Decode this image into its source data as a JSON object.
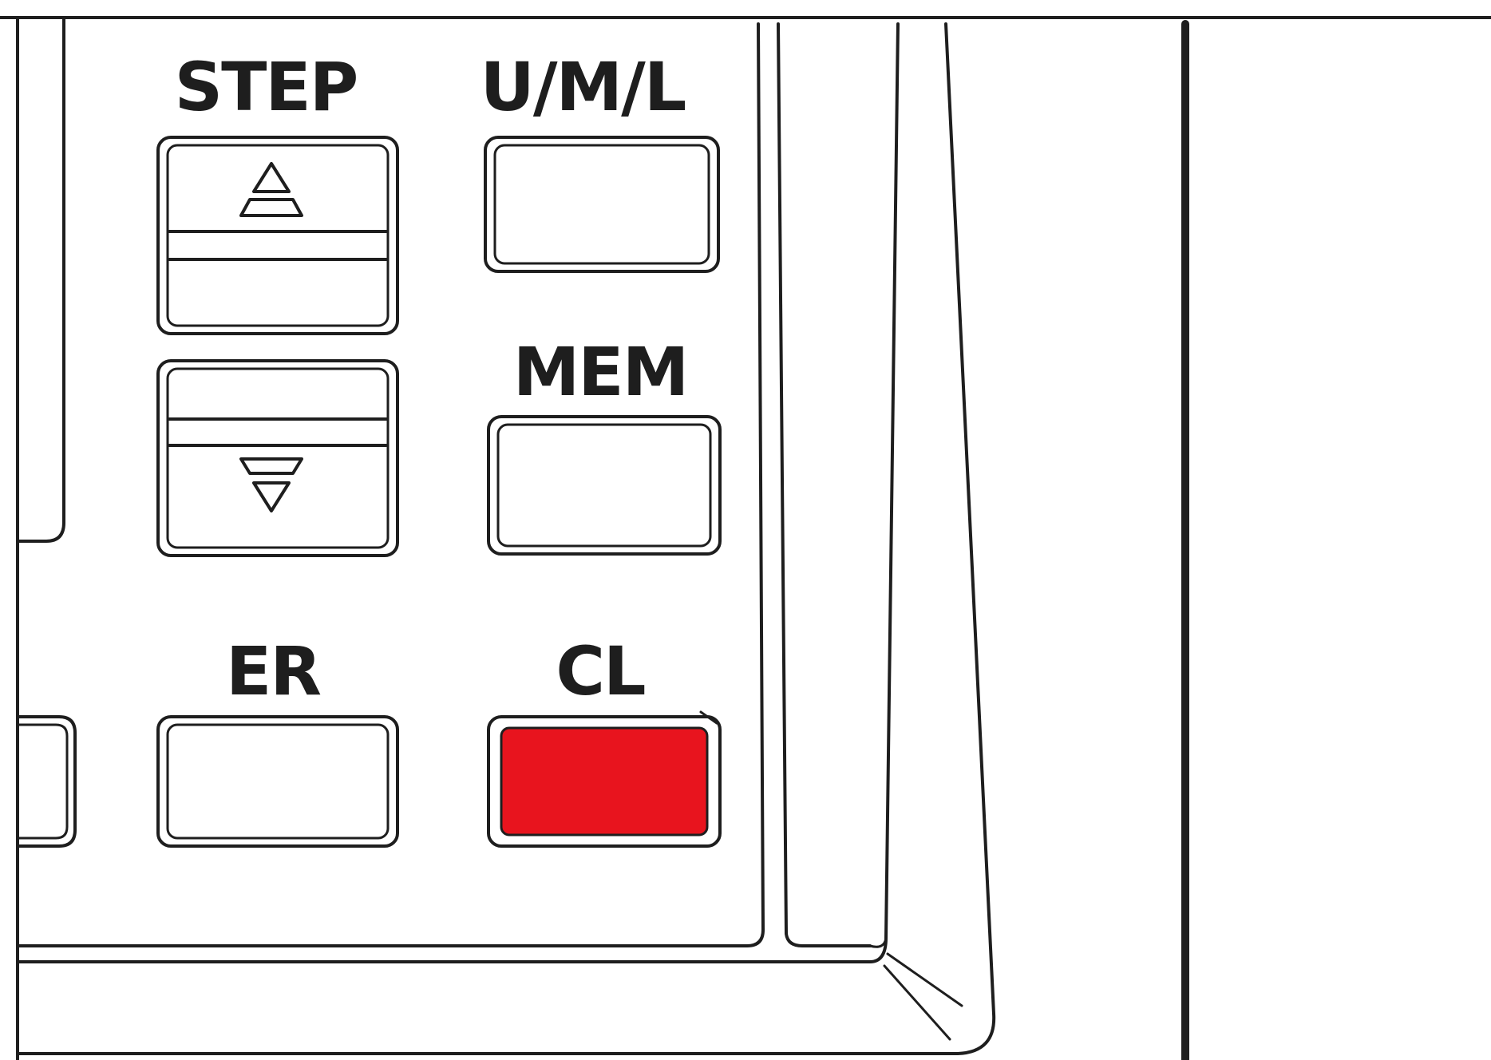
{
  "keypad": {
    "labels": {
      "step": "STEP",
      "uml": "U/M/L",
      "mem": "MEM",
      "er": "ER",
      "cl": "CL"
    }
  },
  "icons": {
    "step_up": "triangle-up-with-bar-icon",
    "step_down": "triangle-down-with-bar-icon"
  },
  "colors": {
    "ink": "#1e1e1e",
    "background": "#ffffff",
    "cl_button": "#e8141e"
  }
}
